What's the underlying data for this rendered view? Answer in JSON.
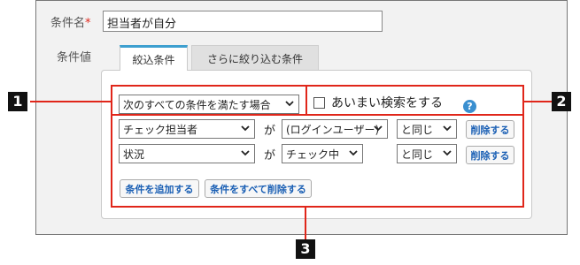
{
  "form": {
    "condition_name_label": "条件名",
    "required_mark": "*",
    "condition_name_value": "担当者が自分",
    "condition_value_label": "条件値"
  },
  "tabs": [
    {
      "label": "絞込条件",
      "active": true
    },
    {
      "label": "さらに絞り込む条件",
      "active": false
    }
  ],
  "match_select": {
    "value": "次のすべての条件を満たす場合"
  },
  "fuzzy_search": {
    "label": "あいまい検索をする",
    "checked": false,
    "help_icon": "?"
  },
  "conditions": [
    {
      "field": "チェック担当者",
      "particle": "が",
      "value": "(ログインユーザー)",
      "operator": "と同じ",
      "delete_label": "削除する"
    },
    {
      "field": "状況",
      "particle": "が",
      "value": "チェック中",
      "operator": "と同じ",
      "delete_label": "削除する"
    }
  ],
  "buttons": {
    "add_condition": "条件を追加する",
    "delete_all": "条件をすべて削除する"
  },
  "callouts": [
    "1",
    "2",
    "3"
  ],
  "colors": {
    "callout_red": "#e0261a",
    "tab_accent": "#3d9fcf",
    "help_blue": "#3a8fd0",
    "button_text": "#1a5fb4"
  }
}
